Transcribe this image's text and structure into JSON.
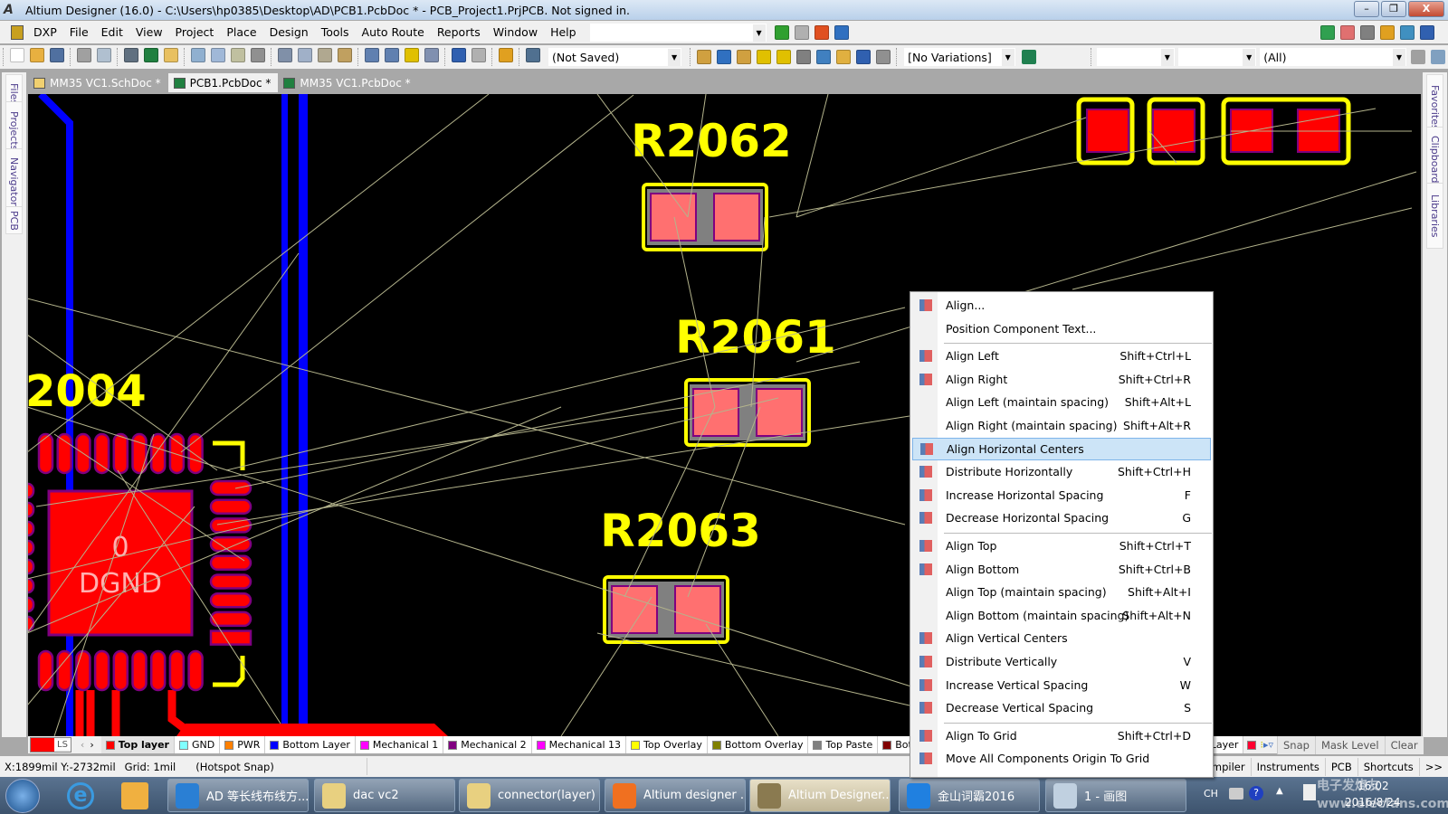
{
  "window": {
    "title": "Altium Designer (16.0) - C:\\Users\\hp0385\\Desktop\\AD\\PCB1.PcbDoc * - PCB_Project1.PrjPCB. Not signed in.",
    "minimize": "–",
    "restore": "❐",
    "close": "X"
  },
  "menubar": {
    "items": [
      "DXP",
      "File",
      "Edit",
      "View",
      "Project",
      "Place",
      "Design",
      "Tools",
      "Auto Route",
      "Reports",
      "Window",
      "Help"
    ],
    "address_value": ""
  },
  "toolbar": {
    "icons_left": [
      {
        "name": "new-icon",
        "color": "#ffffff"
      },
      {
        "name": "open-icon",
        "color": "#e8b040"
      },
      {
        "name": "save-icon",
        "color": "#5070a0"
      },
      {
        "name": "print-icon",
        "color": "#a0a0a0"
      },
      {
        "name": "print-preview-icon",
        "color": "#b0c0d0"
      },
      {
        "name": "3d-view-icon",
        "color": "#607080"
      },
      {
        "name": "board-icon",
        "color": "#208040"
      },
      {
        "name": "sheet-icon",
        "color": "#e8c060"
      },
      {
        "name": "zoom-fit-icon",
        "color": "#90b0d0"
      },
      {
        "name": "zoom-area-icon",
        "color": "#a0b8d8"
      },
      {
        "name": "zoom-selected-icon",
        "color": "#c0c0a0"
      },
      {
        "name": "filter-zoom-icon",
        "color": "#909090"
      },
      {
        "name": "cut-icon",
        "color": "#8090a8"
      },
      {
        "name": "copy-icon",
        "color": "#a0b0c8"
      },
      {
        "name": "paste-icon",
        "color": "#b0a890"
      },
      {
        "name": "rubber-stamp-icon",
        "color": "#c0a060"
      },
      {
        "name": "select-area-icon",
        "color": "#6080b0"
      },
      {
        "name": "move-icon",
        "color": "#6080b0"
      },
      {
        "name": "deselect-icon",
        "color": "#e0c000"
      },
      {
        "name": "clear-filter-icon",
        "color": "#8090b0"
      },
      {
        "name": "undo-icon",
        "color": "#3060b0"
      },
      {
        "name": "redo-icon",
        "color": "#b0b0b0"
      },
      {
        "name": "cross-probe-icon",
        "color": "#e0a020"
      },
      {
        "name": "browse-components-icon",
        "color": "#507090"
      }
    ],
    "variant_combo": "(Not Saved)",
    "icons_mid": [
      {
        "name": "interactive-route-icon",
        "color": "#d0a040"
      },
      {
        "name": "diff-pair-route-icon",
        "color": "#3070c0"
      },
      {
        "name": "multi-route-icon",
        "color": "#d0a040"
      },
      {
        "name": "via-icon",
        "color": "#e0c000"
      },
      {
        "name": "pad-icon",
        "color": "#e0c000"
      },
      {
        "name": "arc-icon",
        "color": "#808080"
      },
      {
        "name": "fill-icon",
        "color": "#4080c0"
      },
      {
        "name": "polygon-icon",
        "color": "#e0b040"
      },
      {
        "name": "string-icon",
        "color": "#3060b0"
      },
      {
        "name": "component-icon",
        "color": "#909090"
      }
    ],
    "variations_combo": "[No Variations]",
    "nav_icons": [
      {
        "name": "back-icon",
        "color": "#30a030"
      },
      {
        "name": "forward-icon",
        "color": "#b0b0b0"
      },
      {
        "name": "home-icon",
        "color": "#e05020"
      },
      {
        "name": "refresh-doc-icon",
        "color": "#3070c0"
      }
    ],
    "right_icons": [
      {
        "name": "measure-icon",
        "color": "#30a050"
      },
      {
        "name": "align-icon",
        "color": "#e07070"
      },
      {
        "name": "find-icon",
        "color": "#808080"
      },
      {
        "name": "dimension-icon",
        "color": "#e0a020"
      },
      {
        "name": "room-icon",
        "color": "#4090c0"
      },
      {
        "name": "grid-icon",
        "color": "#3060b0"
      }
    ],
    "combo_blank1": "",
    "combo_blank2": "",
    "filter_combo": "(All)"
  },
  "left_panel": [
    "Files",
    "Projects",
    "Navigator",
    "PCB"
  ],
  "right_panel": [
    "Favorites",
    "Clipboard",
    "Libraries"
  ],
  "doc_tabs": [
    {
      "label": "MM35 VC1.SchDoc *",
      "active": false
    },
    {
      "label": "PCB1.PcbDoc *",
      "active": true
    },
    {
      "label": "MM35 VC1.PcbDoc *",
      "active": false
    }
  ],
  "pcb": {
    "designators": [
      "R2062",
      "R2061",
      "R2063",
      "2004"
    ],
    "pad_net": "0",
    "pad_net_name": "DGND",
    "colors": {
      "top_layer": "#ff0000",
      "bottom_layer": "#0000ff",
      "overlay": "#ffff00",
      "pad_mask": "#800080",
      "ratsnest": "#b4b48c",
      "pad_pink": "#ff7070",
      "gap_gray": "#808080"
    }
  },
  "layer_bar": {
    "current_color": "#ff0000",
    "ls": "LS",
    "layers": [
      {
        "name": "Top layer",
        "color": "#ff0000",
        "active": true
      },
      {
        "name": "GND",
        "color": "#80ffff"
      },
      {
        "name": "PWR",
        "color": "#ff8000"
      },
      {
        "name": "Bottom Layer",
        "color": "#0000ff"
      },
      {
        "name": "Mechanical 1",
        "color": "#ff00ff"
      },
      {
        "name": "Mechanical 2",
        "color": "#800080"
      },
      {
        "name": "Mechanical 13",
        "color": "#ff00ff"
      },
      {
        "name": "Top Overlay",
        "color": "#ffff00"
      },
      {
        "name": "Bottom Overlay",
        "color": "#808000"
      },
      {
        "name": "Top Paste",
        "color": "#808080"
      },
      {
        "name": "Bottom Pa",
        "color": "#800000"
      }
    ],
    "hidden_tail": "ut Layer",
    "snap": "Snap",
    "mask_level": "Mask Level",
    "clear": "Clear"
  },
  "status": {
    "coords": "X:1899mil Y:-2732mil",
    "grid": "Grid: 1mil",
    "snap": "(Hotspot Snap)",
    "panels": [
      "Compiler",
      "Instruments",
      "PCB",
      "Shortcuts",
      ">>"
    ]
  },
  "context_menu": {
    "items": [
      {
        "label": "Align...",
        "shortcut": "",
        "icon": "align-icon"
      },
      {
        "label": "Position Component Text...",
        "shortcut": ""
      },
      {
        "sep": true
      },
      {
        "label": "Align Left",
        "shortcut": "Shift+Ctrl+L",
        "icon": "align-left-icon"
      },
      {
        "label": "Align Right",
        "shortcut": "Shift+Ctrl+R",
        "icon": "align-right-icon"
      },
      {
        "label": "Align Left (maintain spacing)",
        "shortcut": "Shift+Alt+L"
      },
      {
        "label": "Align Right (maintain spacing)",
        "shortcut": "Shift+Alt+R"
      },
      {
        "label": "Align Horizontal Centers",
        "shortcut": "",
        "icon": "align-horizontal-centers-icon",
        "highlighted": true
      },
      {
        "label": "Distribute Horizontally",
        "shortcut": "Shift+Ctrl+H",
        "icon": "distribute-horizontally-icon"
      },
      {
        "label": "Increase Horizontal Spacing",
        "shortcut": "F",
        "icon": "increase-horizontal-spacing-icon"
      },
      {
        "label": "Decrease Horizontal Spacing",
        "shortcut": "G",
        "icon": "decrease-horizontal-spacing-icon"
      },
      {
        "sep": true
      },
      {
        "label": "Align Top",
        "shortcut": "Shift+Ctrl+T",
        "icon": "align-top-icon"
      },
      {
        "label": "Align Bottom",
        "shortcut": "Shift+Ctrl+B",
        "icon": "align-bottom-icon"
      },
      {
        "label": "Align Top (maintain spacing)",
        "shortcut": "Shift+Alt+I"
      },
      {
        "label": "Align Bottom (maintain spacing)",
        "shortcut": "Shift+Alt+N"
      },
      {
        "label": "Align Vertical Centers",
        "shortcut": "",
        "icon": "align-vertical-centers-icon"
      },
      {
        "label": "Distribute Vertically",
        "shortcut": "V",
        "icon": "distribute-vertically-icon"
      },
      {
        "label": "Increase Vertical Spacing",
        "shortcut": "W",
        "icon": "increase-vertical-spacing-icon"
      },
      {
        "label": "Decrease Vertical Spacing",
        "shortcut": "S",
        "icon": "decrease-vertical-spacing-icon"
      },
      {
        "sep": true
      },
      {
        "label": "Align To Grid",
        "shortcut": "Shift+Ctrl+D",
        "icon": "align-to-grid-icon"
      },
      {
        "label": "Move All Components Origin To Grid",
        "shortcut": "",
        "icon": "move-origin-to-grid-icon"
      }
    ]
  },
  "taskbar": {
    "buttons": [
      {
        "label": "AD 等长线布线方...",
        "icon": "sogou-icon",
        "color": "#2a7fd4"
      },
      {
        "label": "dac vc2",
        "icon": "folder-icon",
        "color": "#e8d080"
      },
      {
        "label": "connector(layer)",
        "icon": "folder-icon",
        "color": "#e8d080"
      },
      {
        "label": "Altium designer ...",
        "icon": "pdf-icon",
        "color": "#f07020"
      },
      {
        "label": "Altium Designer...",
        "icon": "altium-icon",
        "color": "#8a7a50",
        "active": true
      },
      {
        "label": "金山词霸2016",
        "icon": "dictionary-icon",
        "color": "#2080e0"
      },
      {
        "label": "1 - 画图",
        "icon": "paint-icon",
        "color": "#c0d0e0"
      }
    ],
    "tray": {
      "lang": "CH",
      "time": "16:02",
      "date": "2016/8/24"
    },
    "watermark": "电子发烧友 www.elecfans.com"
  }
}
